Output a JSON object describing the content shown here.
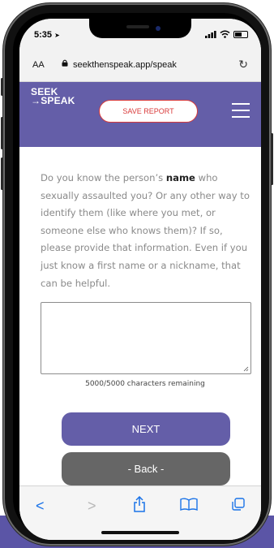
{
  "status_bar": {
    "time": "5:35",
    "location_arrow": "➤"
  },
  "browser": {
    "text_size_label": "AA",
    "url": "seekthenspeak.app/speak"
  },
  "header": {
    "logo_line1": "SEEK",
    "logo_line2": "→SPEAK",
    "save_report_label": "SAVE REPORT"
  },
  "question": {
    "part1": "Do you know the person’s ",
    "bold_word": "name",
    "part2": " who sexually assaulted you? Or any other way to identify them (like where you met, or someone else who knows them)? If so, please provide that information. Even if you just know a first name or a nickname, that can be helpful."
  },
  "answer_field": {
    "value": ""
  },
  "char_counter": "5000/5000 characters remaining",
  "buttons": {
    "next_label": "NEXT",
    "back_label": "- Back -"
  },
  "colors": {
    "brand": "#645ea8",
    "save_red": "#d93a3a",
    "back_gray": "#666666",
    "ios_blue": "#1a73e8"
  }
}
